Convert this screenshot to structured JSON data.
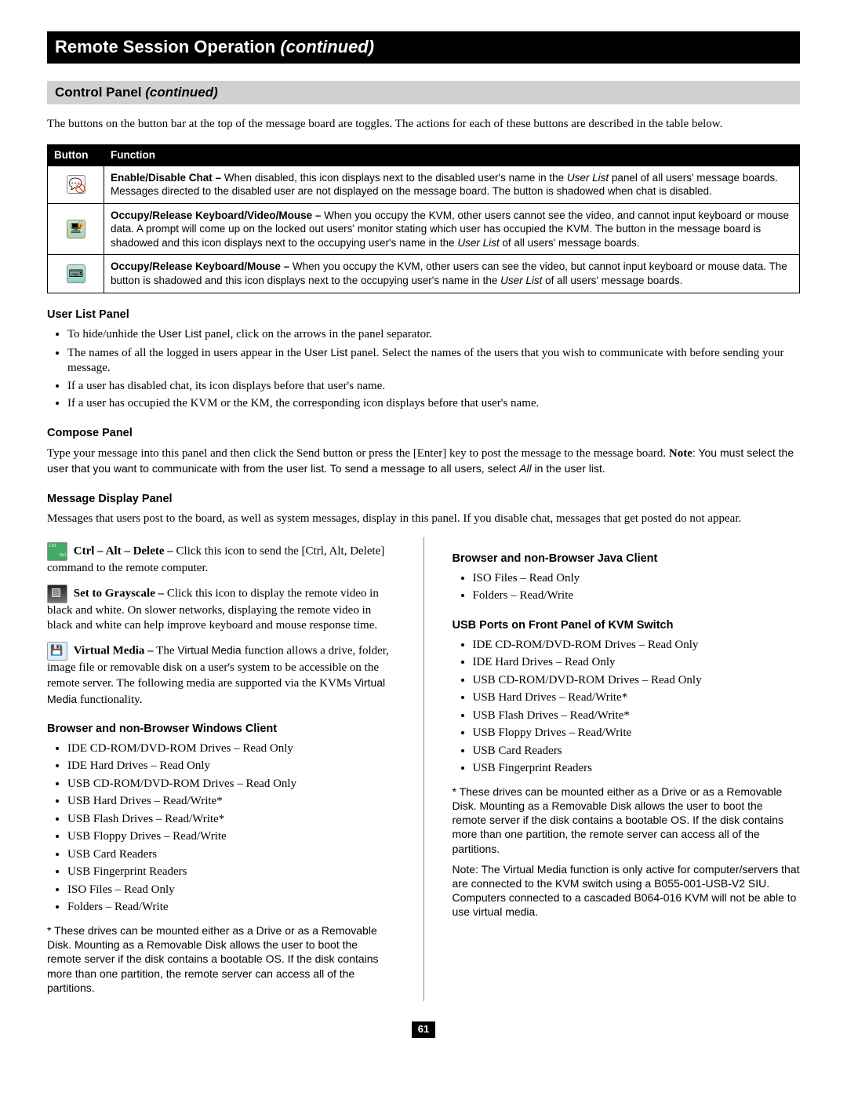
{
  "header": {
    "title": "Remote Session Operation",
    "suffix": "(continued)"
  },
  "subheader": {
    "title": "Control Panel",
    "suffix": "(continued)"
  },
  "intro": "The buttons on the button bar at the top of the message board are toggles. The actions for each of these buttons are described in the table below.",
  "table": {
    "head": {
      "c1": "Button",
      "c2": "Function"
    },
    "rows": [
      {
        "icon": "chat-disable-icon",
        "b": "Enable/Disable Chat –",
        "t1": " When disabled, this icon displays next to the disabled user's name in the ",
        "i1": "User List",
        "t2": " panel of all users' message boards. Messages directed to the disabled user are not displayed on the message board. The button is shadowed when chat is disabled."
      },
      {
        "icon": "occupy-kvm-icon",
        "b": "Occupy/Release Keyboard/Video/Mouse –",
        "t1": " When you occupy the KVM, other users cannot see the video, and cannot input keyboard or mouse data. A prompt will come up on the locked out users' monitor stating which user has occupied the KVM. The button in the message board is shadowed and this icon displays next to the occupying user's name in the ",
        "i1": "User List",
        "t2": " of all users' message boards."
      },
      {
        "icon": "occupy-km-icon",
        "b": "Occupy/Release Keyboard/Mouse –",
        "t1": " When you occupy the KVM, other users can see the video, but cannot input keyboard or mouse data. The button is shadowed and this icon displays next to the occupying user's name in the ",
        "i1": "User List",
        "t2": " of all users' message boards."
      }
    ]
  },
  "user_list": {
    "heading": "User List Panel",
    "items": [
      {
        "pre": "To hide/unhide the ",
        "sans": "User List ",
        "post": "panel, click on the arrows in the panel separator."
      },
      {
        "pre": "The names of all the logged in users appear in the ",
        "sans": "User List ",
        "post": "panel. Select the names of the users that you wish to communicate with before sending your message."
      },
      {
        "pre": "If a user has disabled chat, its icon displays before that user's name.",
        "sans": "",
        "post": ""
      },
      {
        "pre": "If a user has occupied the KVM or the KM, the corresponding icon displays before that user's name.",
        "sans": "",
        "post": ""
      }
    ]
  },
  "compose": {
    "heading": "Compose Panel",
    "p1": "Type your message into this panel and then click the Send button or press the [Enter] key to post the message to the message board. ",
    "note_b": "Note",
    "p2": ": You must select the user that you want to communicate with from the user list. To send a message to all users, select ",
    "i1": "All",
    "p3": " in the user list."
  },
  "msg_panel": {
    "heading": "Message Display Panel",
    "text": "Messages that users post to the board, as well as system messages, display in this panel. If you disable chat, messages that get posted do not appear."
  },
  "left": {
    "cad_b": "Ctrl – Alt – Delete –",
    "cad_t": " Click this icon to send the [Ctrl, Alt, Delete] command to the remote computer.",
    "gray_b": "Set to Grayscale –",
    "gray_t": " Click this icon to display the remote video in black and white. On slower networks, displaying the remote video in black and white can help improve keyboard and mouse response time.",
    "vm_b": "Virtual Media –",
    "vm_t1": " The ",
    "vm_sans": "Virtual Media ",
    "vm_t2": "function allows a drive, folder, image file or removable disk on a user's system to be accessible on the remote server. The following media are supported via the KVMs ",
    "vm_sans2": "Virtual Media ",
    "vm_t3": "functionality.",
    "h_win": "Browser and non-Browser Windows Client",
    "win_items": [
      "IDE CD-ROM/DVD-ROM Drives – Read Only",
      "IDE Hard Drives – Read Only",
      "USB CD-ROM/DVD-ROM Drives – Read Only",
      "USB Hard Drives – Read/Write*",
      "USB Flash Drives – Read/Write*",
      "USB Floppy Drives – Read/Write",
      "USB Card Readers",
      "USB Fingerprint Readers",
      "ISO Files – Read Only",
      "Folders – Read/Write"
    ],
    "foot": "* These drives can be mounted either as a Drive or as a Removable Disk. Mounting as a Removable Disk allows the user to boot the remote server if the disk contains a bootable OS. If the disk contains more than one partition, the remote server can access all of the partitions."
  },
  "right": {
    "h_java": "Browser and non-Browser Java Client",
    "java_items": [
      "ISO Files – Read Only",
      "Folders – Read/Write"
    ],
    "h_usb": "USB Ports on Front Panel of KVM Switch",
    "usb_items": [
      "IDE CD-ROM/DVD-ROM Drives – Read Only",
      "IDE Hard Drives – Read Only",
      "USB CD-ROM/DVD-ROM Drives – Read Only",
      "USB Hard Drives – Read/Write*",
      "USB Flash Drives – Read/Write*",
      "USB Floppy Drives – Read/Write",
      "USB Card Readers",
      "USB Fingerprint Readers"
    ],
    "foot1": "* These drives can be mounted either as a Drive or as a Removable Disk. Mounting as a Removable Disk allows the user to boot the remote server if the disk contains a bootable OS. If the disk contains more than one partition, the remote server can access all of the partitions.",
    "foot2": "Note: The Virtual Media function is only active for computer/servers that are connected to the KVM switch using a B055-001-USB-V2 SIU. Computers connected to a cascaded B064-016 KVM will not be able to use virtual media."
  },
  "page": "61"
}
